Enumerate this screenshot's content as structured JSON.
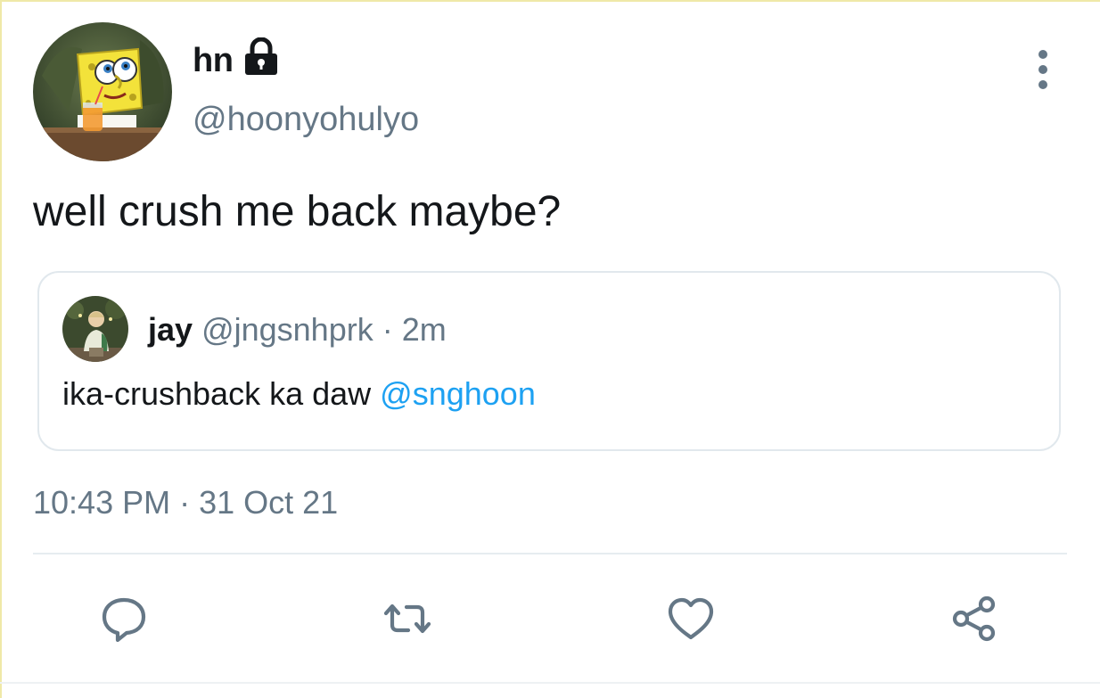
{
  "tweet": {
    "author": {
      "display_name": "hn",
      "handle": "@hoonyohulyo",
      "avatar_icon": "spongebob-avatar",
      "protected_icon": "lock-icon"
    },
    "text": "well crush me back maybe?",
    "quoted": {
      "display_name": "jay",
      "handle": "@jngsnhprk",
      "separator": "·",
      "time": "2m",
      "text": "ika-crushback ka daw",
      "mention": "@snghoon",
      "avatar_icon": "person-avatar"
    },
    "timestamp": "10:43 PM · 31 Oct 21",
    "actions": [
      {
        "name": "reply",
        "icon": "speech-bubble-icon"
      },
      {
        "name": "retweet",
        "icon": "retweet-icon"
      },
      {
        "name": "like",
        "icon": "heart-icon"
      },
      {
        "name": "share",
        "icon": "share-icon"
      }
    ]
  },
  "colors": {
    "primary_text": "#14171a",
    "secondary_text": "#657786",
    "link": "#1da1f2",
    "border": "#e1e8ed"
  }
}
